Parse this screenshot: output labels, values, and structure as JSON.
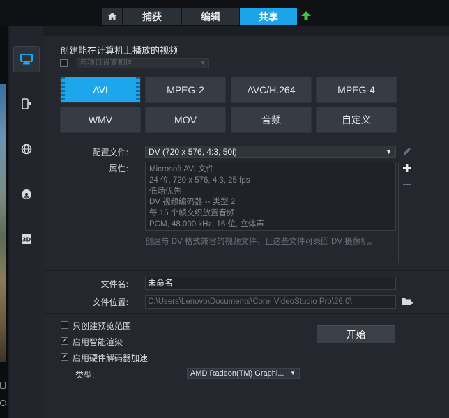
{
  "tabs": {
    "home_icon": "home-icon",
    "capture": "捕获",
    "edit": "编辑",
    "share": "共享",
    "active": "share",
    "upload_icon": "upload-arrow-icon"
  },
  "sidebar": {
    "items": [
      {
        "icon": "computer-icon",
        "active": true
      },
      {
        "icon": "device-icon",
        "active": false
      },
      {
        "icon": "globe-icon",
        "active": false
      },
      {
        "icon": "disc-icon",
        "active": false
      },
      {
        "icon": "3d-icon",
        "active": false
      }
    ]
  },
  "panel": {
    "title": "创建能在计算机上播放的视频",
    "match_project_label": "与项目设置相同",
    "formats": [
      "AVI",
      "MPEG-2",
      "AVC/H.264",
      "MPEG-4",
      "WMV",
      "MOV",
      "音频",
      "自定义"
    ],
    "selected_format": "AVI"
  },
  "profile": {
    "label": "配置文件:",
    "value": "DV (720 x 576, 4:3, 50i)",
    "properties_label": "属性:",
    "properties": [
      "Microsoft AVI 文件",
      "24 位, 720 x 576, 4:3, 25 fps",
      "低场优先",
      "DV 视频编码器 -- 类型 2",
      "每 15 个帧交织放置音频",
      "PCM, 48.000 kHz, 16 位, 立体声"
    ],
    "description": "创建与 DV 格式兼容的视频文件，且这些文件可录回 DV 摄像机。"
  },
  "file": {
    "name_label": "文件名:",
    "name_value": "未命名",
    "location_label": "文件位置:",
    "location_value": "C:\\Users\\Lenovo\\Documents\\Corel VideoStudio Pro\\26.0\\"
  },
  "options": {
    "preview_range": {
      "label": "只创建预览范围",
      "checked": false
    },
    "smart_render": {
      "label": "启用智能渲染",
      "checked": true
    },
    "hw_decoder": {
      "label": "启用硬件解码器加速",
      "checked": true
    },
    "type_label": "类型:",
    "type_value": "AMD Radeon(TM) Graphi..."
  },
  "start_button": "开始",
  "colors": {
    "accent": "#1ea6ec",
    "panel_bg": "#24282e",
    "upload_green": "#3fc63f"
  }
}
